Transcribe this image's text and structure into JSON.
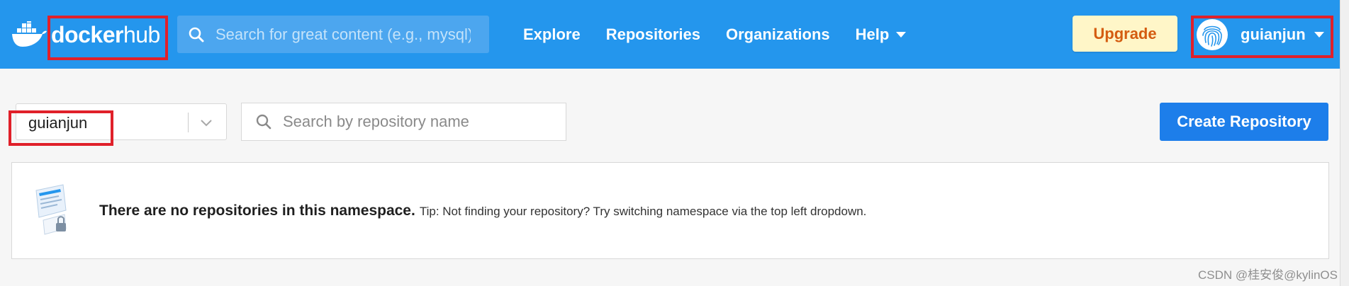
{
  "header": {
    "logo": {
      "word_docker": "docker",
      "word_hub": "hub"
    },
    "search": {
      "placeholder": "Search for great content (e.g., mysql)"
    },
    "nav": [
      {
        "label": "Explore"
      },
      {
        "label": "Repositories"
      },
      {
        "label": "Organizations"
      },
      {
        "label": "Help"
      }
    ],
    "upgrade_label": "Upgrade",
    "user": {
      "name": "guianjun"
    }
  },
  "toolbar": {
    "namespace": {
      "selected": "guianjun"
    },
    "repo_search": {
      "placeholder": "Search by repository name"
    },
    "create_label": "Create Repository"
  },
  "empty_state": {
    "message": "There are no repositories in this namespace.",
    "tip": "Tip: Not finding your repository? Try switching namespace via the top left dropdown."
  },
  "watermark": "CSDN @桂安俊@kylinOS",
  "colors": {
    "brand_blue": "#2496ed",
    "primary_button": "#1d7eea",
    "upgrade_bg": "#fff6c8",
    "upgrade_text": "#d45c10",
    "highlight_box": "#e0202a"
  },
  "icons": [
    "docker-whale-icon",
    "search-icon",
    "caret-down-icon",
    "fingerprint-avatar-icon",
    "chevron-down-icon",
    "repository-lock-illustration"
  ]
}
